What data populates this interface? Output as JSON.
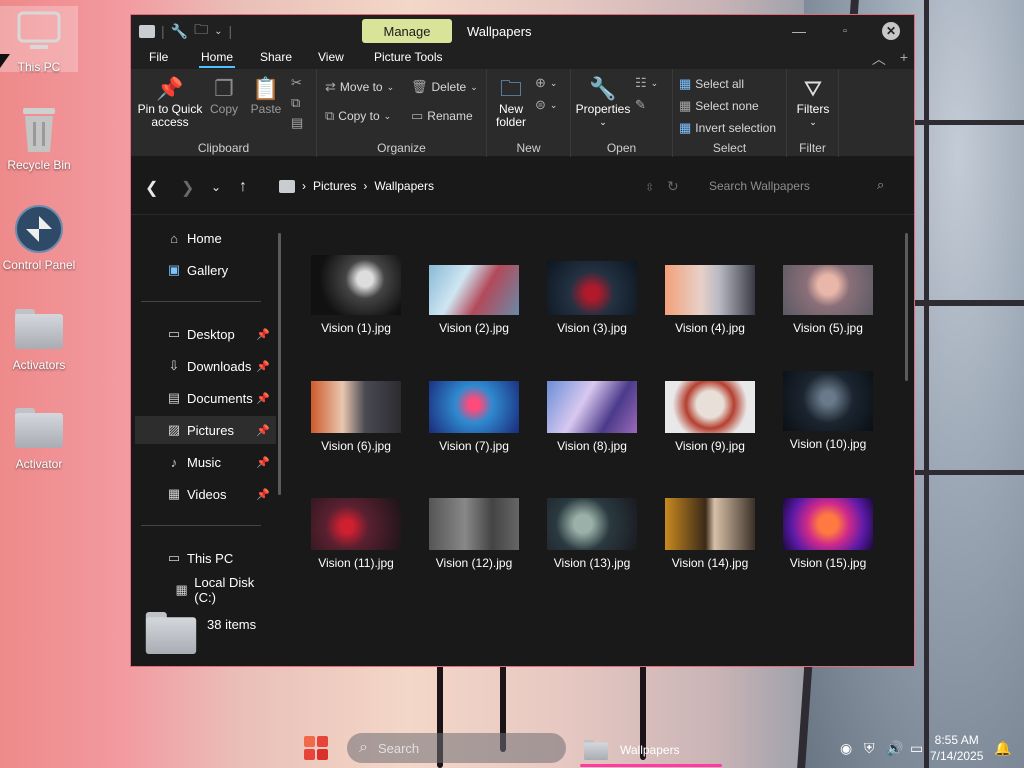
{
  "desktop": {
    "icons": [
      {
        "label": "This PC"
      },
      {
        "label": "Recycle Bin"
      },
      {
        "label": "Control Panel"
      },
      {
        "label": "Activators"
      },
      {
        "label": "Activator"
      }
    ]
  },
  "window": {
    "manage_tab": "Manage",
    "title": "Wallpapers",
    "menu": [
      "File",
      "Home",
      "Share",
      "View",
      "Picture Tools"
    ],
    "active_menu": "Home"
  },
  "ribbon": {
    "clipboard": {
      "pin": "Pin to Quick access",
      "copy": "Copy",
      "paste": "Paste",
      "group": "Clipboard"
    },
    "organize": {
      "move_to": "Move to",
      "copy_to": "Copy to",
      "delete": "Delete",
      "rename": "Rename",
      "group": "Organize"
    },
    "new": {
      "new_folder": "New folder",
      "group": "New"
    },
    "open": {
      "properties": "Properties",
      "group": "Open"
    },
    "select": {
      "select_all": "Select all",
      "select_none": "Select none",
      "invert": "Invert selection",
      "group": "Select"
    },
    "filter": {
      "filters": "Filters",
      "group": "Filter"
    }
  },
  "address": {
    "crumbs": [
      "Pictures",
      "Wallpapers"
    ],
    "search_placeholder": "Search Wallpapers"
  },
  "sidebar": {
    "items": [
      {
        "label": "Home",
        "icon": "home-icon"
      },
      {
        "label": "Gallery",
        "icon": "gallery-icon"
      },
      {
        "label": "Desktop",
        "icon": "desktop-icon"
      },
      {
        "label": "Downloads",
        "icon": "downloads-icon"
      },
      {
        "label": "Documents",
        "icon": "documents-icon"
      },
      {
        "label": "Pictures",
        "icon": "pictures-icon"
      },
      {
        "label": "Music",
        "icon": "music-icon"
      },
      {
        "label": "Videos",
        "icon": "videos-icon"
      },
      {
        "label": "This PC",
        "icon": "pc-icon"
      },
      {
        "label": "Local Disk (C:)",
        "icon": "disk-icon"
      }
    ]
  },
  "status": {
    "items": "38 items"
  },
  "files": [
    {
      "name": "Vision (1).jpg"
    },
    {
      "name": "Vision (2).jpg"
    },
    {
      "name": "Vision (3).jpg"
    },
    {
      "name": "Vision (4).jpg"
    },
    {
      "name": "Vision (5).jpg"
    },
    {
      "name": "Vision (6).jpg"
    },
    {
      "name": "Vision (7).jpg"
    },
    {
      "name": "Vision (8).jpg"
    },
    {
      "name": "Vision (9).jpg"
    },
    {
      "name": "Vision (10).jpg"
    },
    {
      "name": "Vision (11).jpg"
    },
    {
      "name": "Vision (12).jpg"
    },
    {
      "name": "Vision (13).jpg"
    },
    {
      "name": "Vision (14).jpg"
    },
    {
      "name": "Vision (15).jpg"
    }
  ],
  "taskbar": {
    "search": "Search",
    "app": "Wallpapers",
    "time": "8:55 AM",
    "date": "7/14/2025"
  }
}
